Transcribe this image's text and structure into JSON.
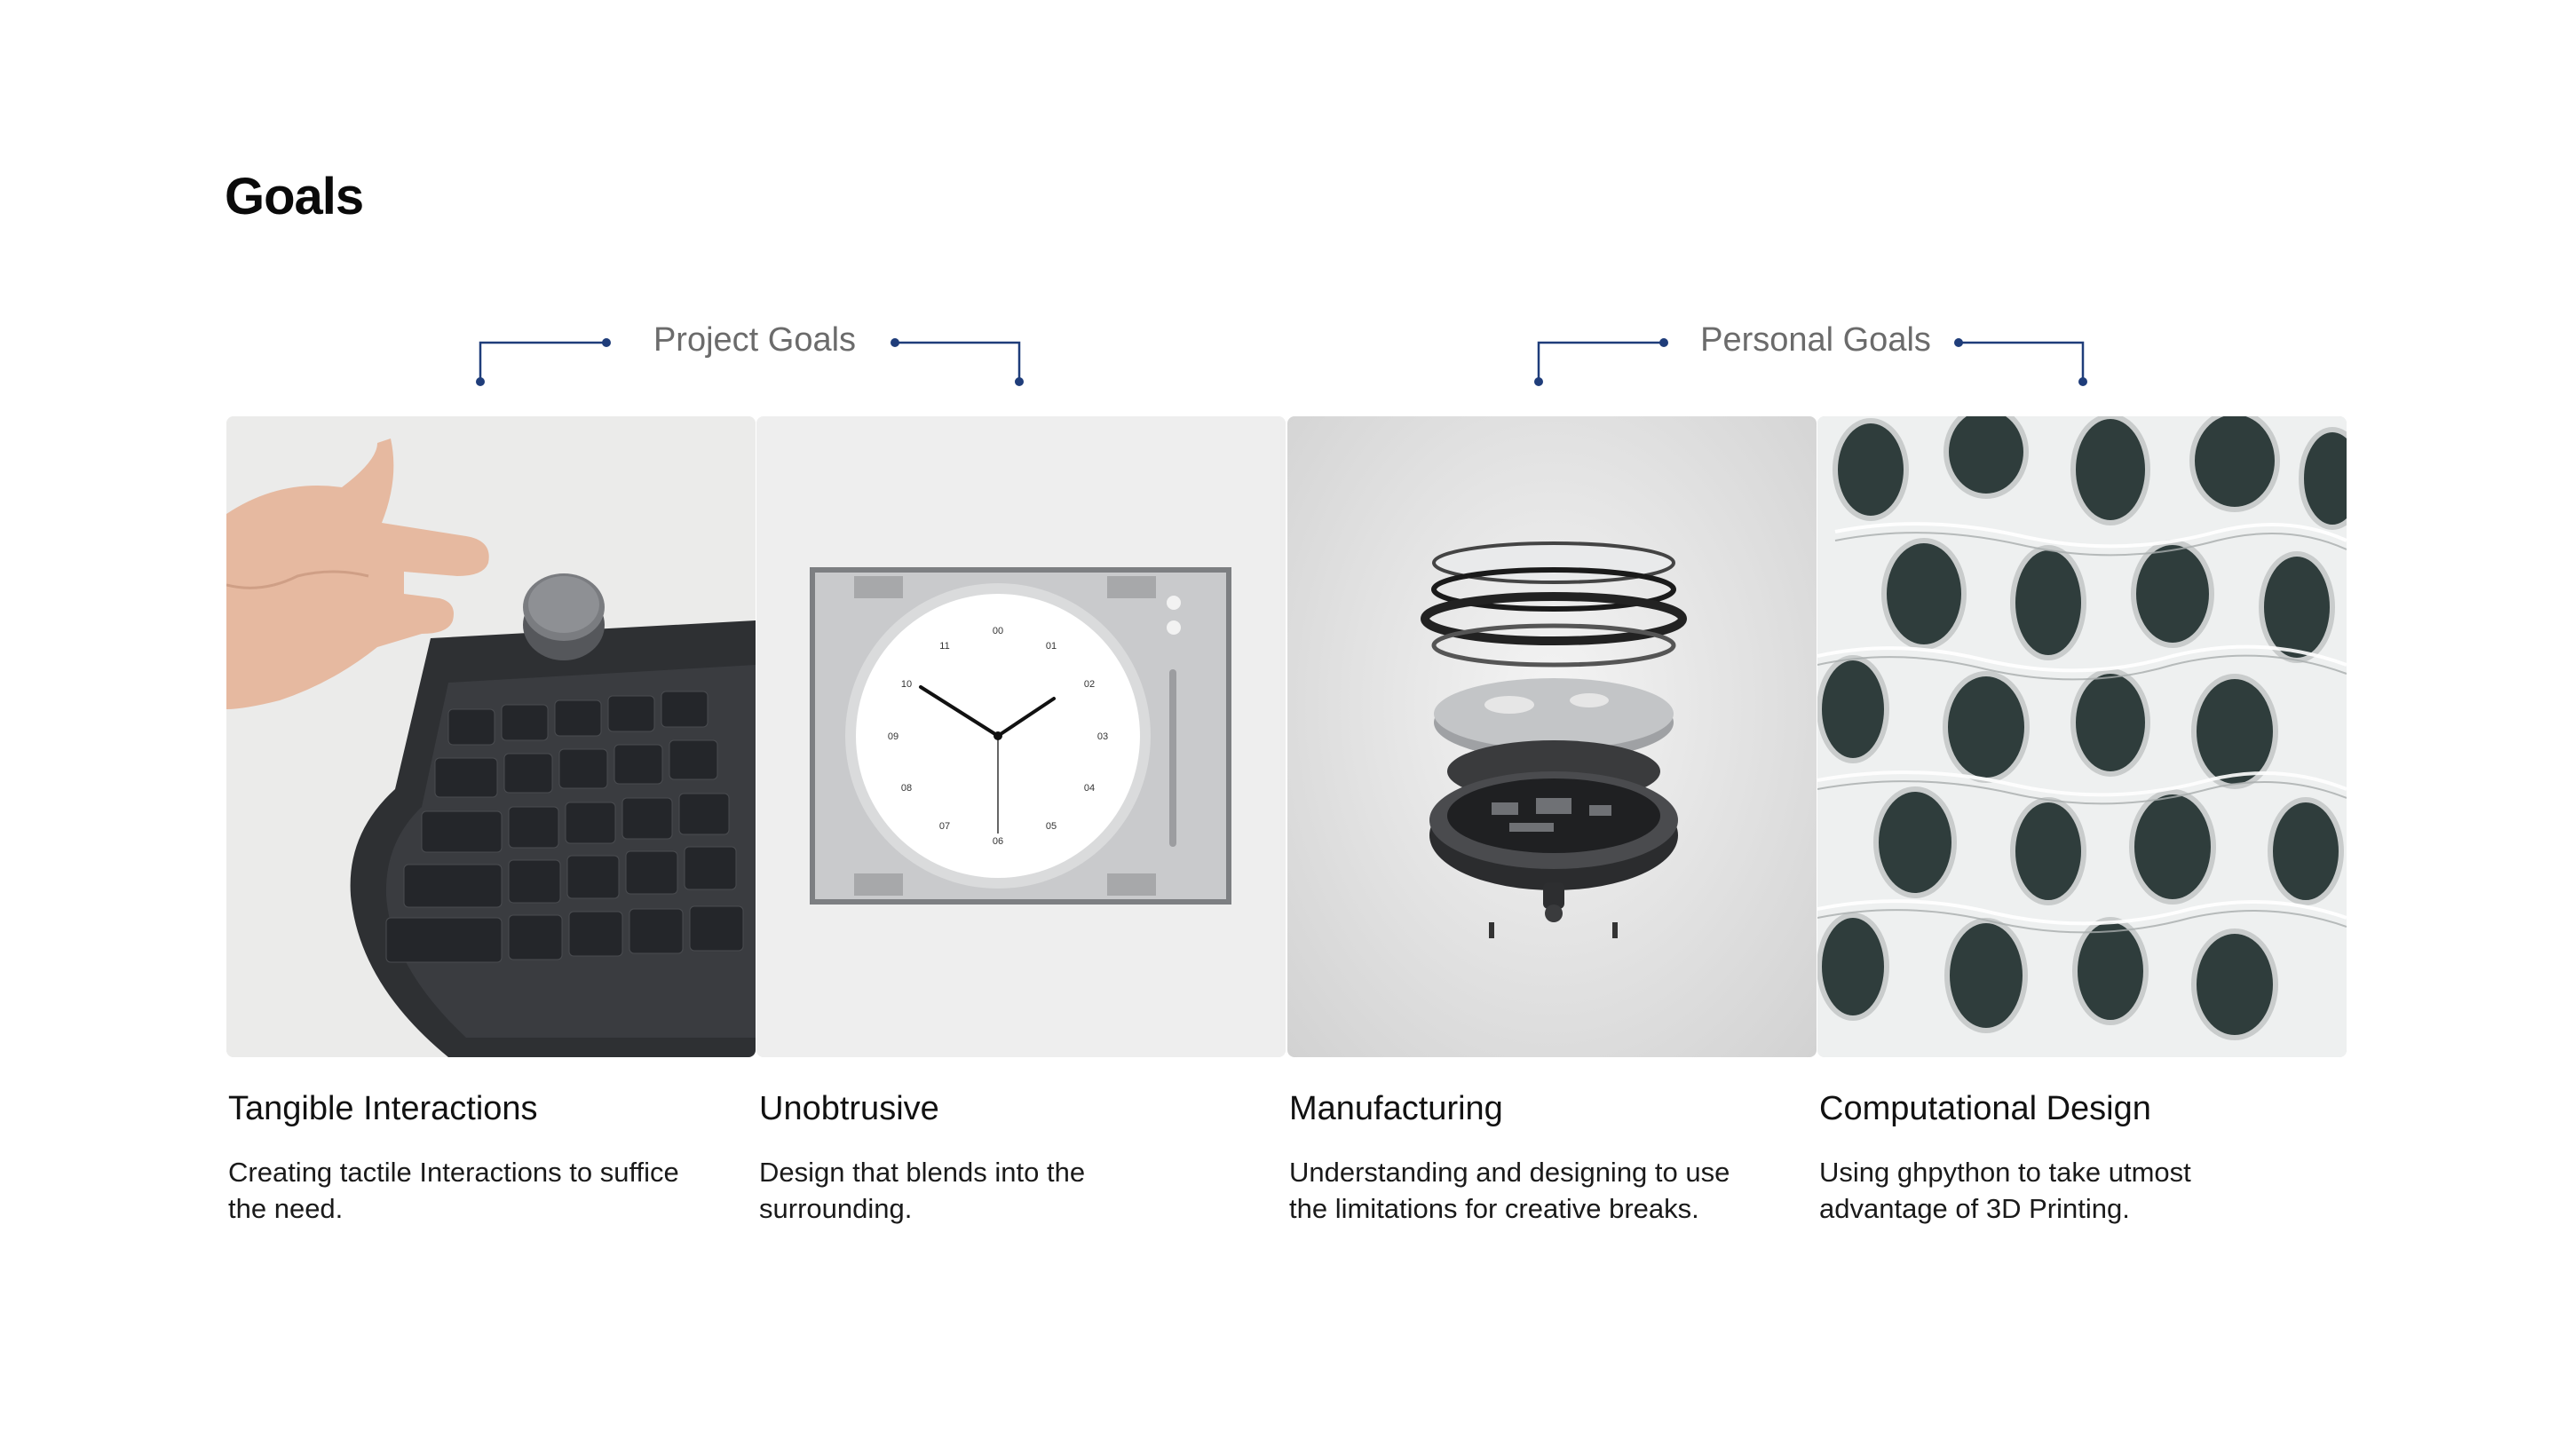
{
  "page": {
    "title": "Goals"
  },
  "groups": {
    "project": "Project Goals",
    "personal": "Personal Goals"
  },
  "cards": [
    {
      "title": "Tangible Interactions",
      "description": "Creating tactile Interactions to suffice the need."
    },
    {
      "title": "Unobtrusive",
      "description": "Design that blends into the surrounding."
    },
    {
      "title": "Manufacturing",
      "description": "Understanding and designing to use the limitations for creative breaks."
    },
    {
      "title": "Computational Design",
      "description": "Using ghpython to take utmost advantage of 3D Printing."
    }
  ],
  "colors": {
    "bracket": "#1f3d7a",
    "group_label": "#6b6b6b"
  },
  "images": [
    "keyboard-photo",
    "wall-clock-photo",
    "exploded-device-photo",
    "parametric-facade-photo"
  ]
}
